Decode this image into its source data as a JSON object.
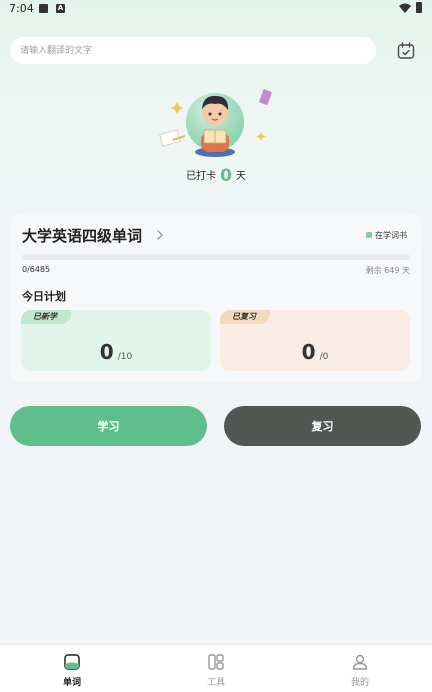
{
  "status_bar": {
    "time": "7:04",
    "a_icon_letter": "A"
  },
  "search": {
    "placeholder": "请输入翻译的文字",
    "value": ""
  },
  "checkin": {
    "prefix": "已打卡",
    "days": "0",
    "suffix": "天"
  },
  "book": {
    "title": "大学英语四级单词",
    "badge": "在学词书",
    "progress_count": "0/6485",
    "progress_fraction": 0,
    "remaining": "剩余 649 天"
  },
  "plan": {
    "title": "今日计划",
    "new": {
      "tag": "已新学",
      "value": "0",
      "total": "/10"
    },
    "review": {
      "tag": "已复习",
      "value": "0",
      "total": "/0"
    }
  },
  "actions": {
    "study": "学习",
    "review": "复习"
  },
  "bottom_nav": [
    {
      "label": "单词",
      "icon": "words-icon",
      "active": true
    },
    {
      "label": "工具",
      "icon": "tools-icon",
      "active": false
    },
    {
      "label": "我的",
      "icon": "profile-icon",
      "active": false
    }
  ],
  "colors": {
    "accent": "#5fbf8c",
    "dark_button": "#525753",
    "new_bg": "#e2f5ec",
    "review_bg": "#f9ede6"
  }
}
